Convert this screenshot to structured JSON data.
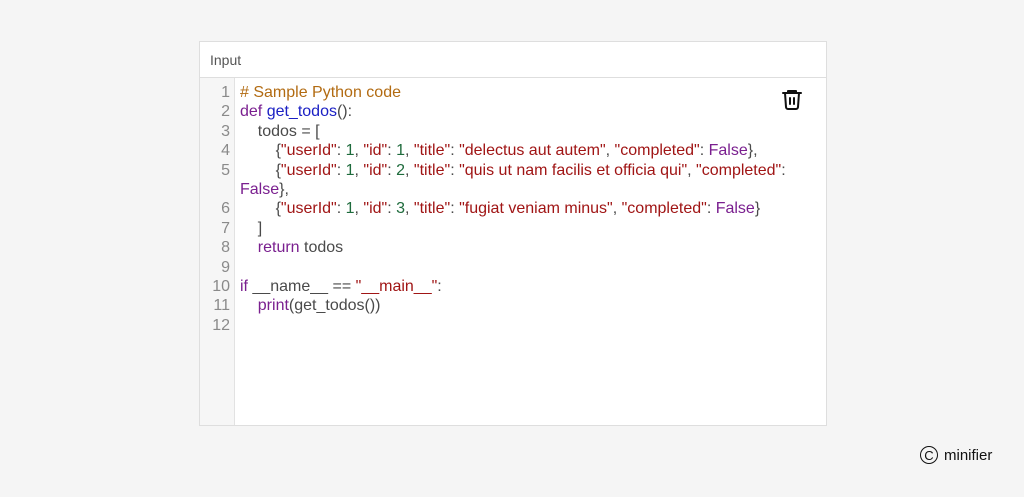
{
  "panel": {
    "label": "Input"
  },
  "icons": {
    "trash": "trash-icon",
    "logo": "copyright-circle-icon"
  },
  "brand": {
    "mark": "C",
    "name": "minifier"
  },
  "editor": {
    "line_numbers": [
      "1",
      "2",
      "3",
      "4",
      "5",
      "6",
      "7",
      "8",
      "9",
      "10",
      "11",
      "12"
    ],
    "lines": [
      {
        "segments": [
          [
            "cm",
            "# Sample Python code"
          ]
        ]
      },
      {
        "segments": [
          [
            "kw",
            "def "
          ],
          [
            "fn",
            "get_todos"
          ],
          [
            "",
            "():"
          ]
        ]
      },
      {
        "segments": [
          [
            "",
            "    todos = ["
          ]
        ]
      },
      {
        "segments": [
          [
            "",
            "        {"
          ],
          [
            "str",
            "\"userId\""
          ],
          [
            "",
            ": "
          ],
          [
            "num",
            "1"
          ],
          [
            "",
            ", "
          ],
          [
            "str",
            "\"id\""
          ],
          [
            "",
            ": "
          ],
          [
            "num",
            "1"
          ],
          [
            "",
            ", "
          ],
          [
            "str",
            "\"title\""
          ],
          [
            "",
            ": "
          ],
          [
            "str",
            "\"delectus aut autem\""
          ],
          [
            "",
            ", "
          ],
          [
            "str",
            "\"completed\""
          ],
          [
            "",
            ": "
          ],
          [
            "bool",
            "False"
          ],
          [
            "",
            "},"
          ]
        ]
      },
      {
        "wrap": true,
        "segments": [
          [
            "",
            "        {"
          ],
          [
            "str",
            "\"userId\""
          ],
          [
            "",
            ": "
          ],
          [
            "num",
            "1"
          ],
          [
            "",
            ", "
          ],
          [
            "str",
            "\"id\""
          ],
          [
            "",
            ": "
          ],
          [
            "num",
            "2"
          ],
          [
            "",
            ", "
          ],
          [
            "str",
            "\"title\""
          ],
          [
            "",
            ": "
          ],
          [
            "str",
            "\"quis ut nam facilis et officia qui\""
          ],
          [
            "",
            ", "
          ],
          [
            "str",
            "\"completed\""
          ],
          [
            "",
            ": "
          ],
          [
            "bool",
            "False"
          ],
          [
            "",
            "},"
          ]
        ]
      },
      {
        "segments": [
          [
            "",
            "        {"
          ],
          [
            "str",
            "\"userId\""
          ],
          [
            "",
            ": "
          ],
          [
            "num",
            "1"
          ],
          [
            "",
            ", "
          ],
          [
            "str",
            "\"id\""
          ],
          [
            "",
            ": "
          ],
          [
            "num",
            "3"
          ],
          [
            "",
            ", "
          ],
          [
            "str",
            "\"title\""
          ],
          [
            "",
            ": "
          ],
          [
            "str",
            "\"fugiat veniam minus\""
          ],
          [
            "",
            ", "
          ],
          [
            "str",
            "\"completed\""
          ],
          [
            "",
            ": "
          ],
          [
            "bool",
            "False"
          ],
          [
            "",
            "}"
          ]
        ]
      },
      {
        "segments": [
          [
            "",
            "    ]"
          ]
        ]
      },
      {
        "segments": [
          [
            "",
            "    "
          ],
          [
            "kw",
            "return"
          ],
          [
            "",
            " todos"
          ]
        ]
      },
      {
        "segments": [
          [
            "",
            ""
          ]
        ]
      },
      {
        "segments": [
          [
            "kw",
            "if"
          ],
          [
            "",
            " __name__ == "
          ],
          [
            "str",
            "\"__main__\""
          ],
          [
            "",
            ":"
          ]
        ]
      },
      {
        "segments": [
          [
            "",
            "    "
          ],
          [
            "kw",
            "print"
          ],
          [
            "",
            "(get_todos())"
          ]
        ]
      },
      {
        "segments": [
          [
            "",
            ""
          ]
        ]
      }
    ]
  }
}
